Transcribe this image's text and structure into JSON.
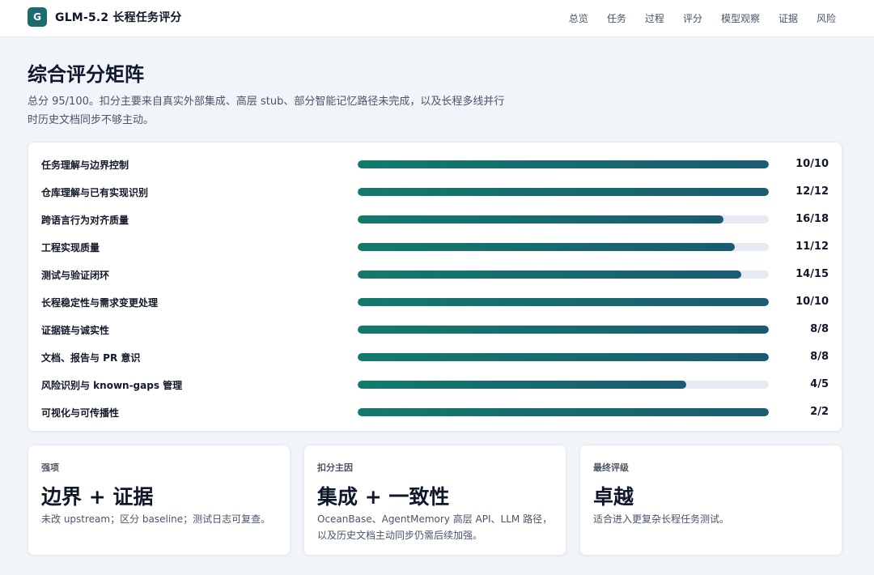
{
  "header": {
    "logo_letter": "G",
    "title": "GLM-5.2 长程任务评分",
    "nav": [
      "总览",
      "任务",
      "过程",
      "评分",
      "模型观察",
      "证据",
      "风险"
    ]
  },
  "page": {
    "title": "综合评分矩阵",
    "description": "总分 95/100。扣分主要来自真实外部集成、高层 stub、部分智能记忆路径未完成，以及长程多线并行时历史文档同步不够主动。"
  },
  "scores": [
    {
      "label": "任务理解与边界控制",
      "value": "10/10",
      "score": 10,
      "max": 10
    },
    {
      "label": "仓库理解与已有实现识别",
      "value": "12/12",
      "score": 12,
      "max": 12
    },
    {
      "label": "跨语言行为对齐质量",
      "value": "16/18",
      "score": 16,
      "max": 18
    },
    {
      "label": "工程实现质量",
      "value": "11/12",
      "score": 11,
      "max": 12
    },
    {
      "label": "测试与验证闭环",
      "value": "14/15",
      "score": 14,
      "max": 15
    },
    {
      "label": "长程稳定性与需求变更处理",
      "value": "10/10",
      "score": 10,
      "max": 10
    },
    {
      "label": "证据链与诚实性",
      "value": "8/8",
      "score": 8,
      "max": 8
    },
    {
      "label": "文档、报告与 PR 意识",
      "value": "8/8",
      "score": 8,
      "max": 8
    },
    {
      "label": "风险识别与 known-gaps 管理",
      "value": "4/5",
      "score": 4,
      "max": 5
    },
    {
      "label": "可视化与可传播性",
      "value": "2/2",
      "score": 2,
      "max": 2
    }
  ],
  "cards": [
    {
      "kicker": "强项",
      "title": "边界 + 证据",
      "text": "未改 upstream；区分 baseline；测试日志可复查。"
    },
    {
      "kicker": "扣分主因",
      "title": "集成 + 一致性",
      "text": "OceanBase、AgentMemory 高层 API、LLM 路径，以及历史文档主动同步仍需后续加强。"
    },
    {
      "kicker": "最终评级",
      "title": "卓越",
      "text": "适合进入更复杂长程任务测试。"
    }
  ],
  "colors": {
    "accent": "#1c6b6e",
    "bar_start": "#137a6b",
    "bar_end": "#1b5b72",
    "track": "#e6ebf2"
  }
}
